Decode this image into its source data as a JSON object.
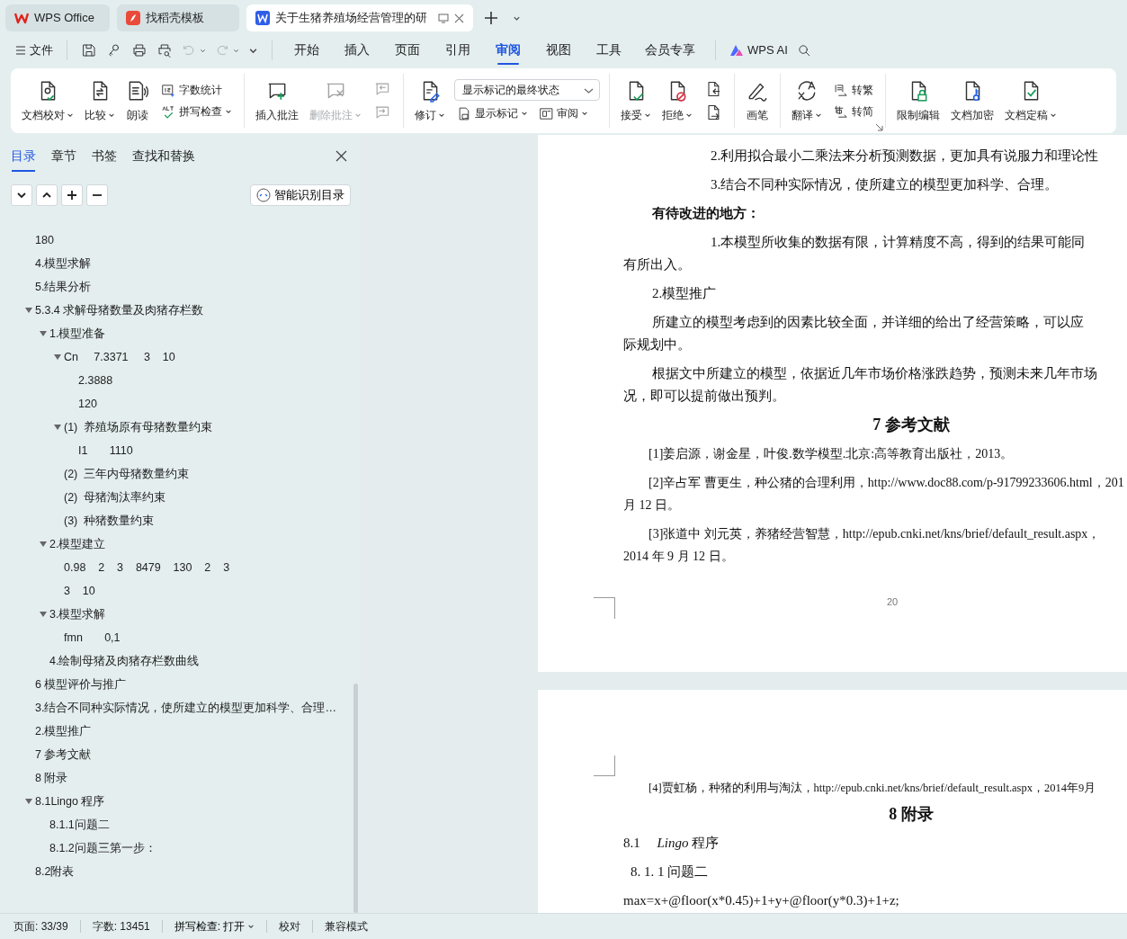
{
  "app_tabs": [
    {
      "kind": "home",
      "title": "WPS Office",
      "selected": false
    },
    {
      "kind": "template",
      "title": "找稻壳模板",
      "selected": false
    },
    {
      "kind": "document",
      "title": "关于生猪养殖场经营管理的研",
      "selected": true
    }
  ],
  "menu": {
    "file": "文件",
    "tabs": [
      {
        "label": "开始",
        "selected": false
      },
      {
        "label": "插入",
        "selected": false
      },
      {
        "label": "页面",
        "selected": false
      },
      {
        "label": "引用",
        "selected": false
      },
      {
        "label": "审阅",
        "selected": true
      },
      {
        "label": "视图",
        "selected": false
      },
      {
        "label": "工具",
        "selected": false
      },
      {
        "label": "会员专享",
        "selected": false
      }
    ],
    "ai": "WPS AI"
  },
  "ribbon": [
    {
      "items": [
        {
          "kind": "big",
          "label": "文档校对",
          "caret": true,
          "disabled": false
        },
        {
          "kind": "big",
          "label": "比较",
          "caret": true,
          "disabled": false
        },
        {
          "kind": "big",
          "label": "朗读",
          "disabled": false
        },
        {
          "kind": "stack",
          "rows": [
            [
              {
                "kind": "small",
                "label": "字数统计",
                "disabled": false
              }
            ],
            [
              {
                "kind": "small",
                "label": "拼写检查",
                "caret": true,
                "disabled": false
              }
            ]
          ]
        }
      ]
    },
    {
      "items": [
        {
          "kind": "big",
          "label": "插入批注",
          "disabled": false
        },
        {
          "kind": "big",
          "label": "删除批注",
          "caret": true,
          "disabled": true
        },
        {
          "kind": "stack",
          "rows": [
            [
              {
                "kind": "small",
                "disabled": true
              }
            ],
            [
              {
                "kind": "small",
                "disabled": true
              }
            ]
          ]
        }
      ]
    },
    {
      "items": [
        {
          "kind": "big",
          "label": "修订",
          "caret": true,
          "disabled": false
        },
        {
          "kind": "stack",
          "rows": [
            [
              {
                "kind": "select",
                "value": "显示标记的最终状态"
              }
            ],
            [
              {
                "kind": "small",
                "label": "显示标记",
                "caret": true,
                "disabled": false
              },
              {
                "kind": "small",
                "label": "审阅",
                "caret": true,
                "disabled": false
              }
            ]
          ]
        }
      ]
    },
    {
      "items": [
        {
          "kind": "big",
          "label": "接受",
          "caret": true,
          "disabled": false
        },
        {
          "kind": "big",
          "label": "拒绝",
          "caret": true,
          "disabled": false
        },
        {
          "kind": "stack",
          "rows": [
            [
              {
                "kind": "small",
                "disabled": false
              }
            ],
            [
              {
                "kind": "small",
                "disabled": false
              }
            ]
          ]
        }
      ]
    },
    {
      "items": [
        {
          "kind": "big",
          "label": "画笔",
          "disabled": false
        }
      ]
    },
    {
      "launcher": true,
      "items": [
        {
          "kind": "big",
          "label": "翻译",
          "caret": true,
          "disabled": false
        },
        {
          "kind": "stack",
          "rows": [
            [
              {
                "kind": "small",
                "label": "转繁",
                "disabled": false
              }
            ],
            [
              {
                "kind": "small",
                "label": "转简",
                "disabled": false
              }
            ]
          ]
        }
      ]
    },
    {
      "items": [
        {
          "kind": "big",
          "label": "限制编辑",
          "disabled": false
        },
        {
          "kind": "big",
          "label": "文档加密",
          "disabled": false
        },
        {
          "kind": "big",
          "label": "文档定稿",
          "caret": true,
          "disabled": false
        }
      ]
    }
  ],
  "sidebar": {
    "tabs": [
      {
        "label": "目录",
        "selected": true
      },
      {
        "label": "章节",
        "selected": false
      },
      {
        "label": "书签",
        "selected": false
      },
      {
        "label": "查找和替换",
        "selected": false
      }
    ],
    "smart_toc_button": "智能识别目录",
    "toc": [
      {
        "text": "180"
      },
      {
        "text": "4.模型求解"
      },
      {
        "text": "5.结果分析"
      },
      {
        "text": "5.3.4 求解母猪数量及肉猪存栏数",
        "expanded": true,
        "children": [
          {
            "text": "1.模型准备",
            "expanded": true,
            "children": [
              {
                "text": "Cn     7.3371     3    10",
                "expanded": true,
                "children": [
                  {
                    "text": "2.3888"
                  },
                  {
                    "text": "120"
                  }
                ]
              },
              {
                "text": "(1)  养殖场原有母猪数量约束",
                "expanded": true,
                "children": [
                  {
                    "text": "I1       1110"
                  }
                ]
              },
              {
                "text": "(2)  三年内母猪数量约束"
              },
              {
                "text": "(2)  母猪淘汰率约束"
              },
              {
                "text": "(3)  种猪数量约束"
              }
            ]
          },
          {
            "text": "2.模型建立",
            "expanded": true,
            "children": [
              {
                "text": "0.98    2    3    8479    130    2    3"
              },
              {
                "text": "3    10"
              }
            ]
          },
          {
            "text": "3.模型求解",
            "expanded": true,
            "children": [
              {
                "text": "fmn       0,1"
              }
            ]
          },
          {
            "text": "4.绘制母猪及肉猪存栏数曲线"
          }
        ]
      },
      {
        "text": "6 模型评价与推广"
      },
      {
        "text": "3.结合不同种实际情况，使所建立的模型更加科学、合理…"
      },
      {
        "text": "2.模型推广"
      },
      {
        "text": "7 参考文献"
      },
      {
        "text": "8 附录"
      },
      {
        "text": "8.1Lingo 程序",
        "expanded": true,
        "children": [
          {
            "text": "8.1.1问题二"
          },
          {
            "text": "8.1.2问题三第一步："
          }
        ]
      },
      {
        "text": "8.2附表"
      }
    ]
  },
  "document": {
    "pages": [
      {
        "page_number": "20",
        "blocks": [
          {
            "kind": "item",
            "lines": [
              "2.利用拟合最小二乘法来分析预测数据，更加具有说服力和理论性"
            ]
          },
          {
            "kind": "item",
            "lines": [
              "3.结合不同种实际情况，使所建立的模型更加科学、合理。"
            ]
          },
          {
            "kind": "label",
            "lines": [
              "有待改进的地方："
            ]
          },
          {
            "kind": "item",
            "lines": [
              "1.本模型所收集的数据有限，计算精度不高，得到的结果可能同",
              "有所出入。"
            ]
          },
          {
            "kind": "label",
            "lines": [
              "2.模型推广"
            ]
          },
          {
            "kind": "text",
            "lines": [
              "所建立的模型考虑到的因素比较全面，并详细的给出了经营策略，可以应",
              "际规划中。"
            ]
          },
          {
            "kind": "text",
            "lines": [
              "根据文中所建立的模型，依据近几年市场价格涨跌趋势，预测未来几年市场",
              "况，即可以提前做出预判。"
            ]
          },
          {
            "kind": "heading",
            "lines": [
              "7 参考文献"
            ]
          },
          {
            "kind": "ref",
            "lines": [
              "[1]姜启源，谢金星，叶俊.数学模型.北京:高等教育出版社，2013。"
            ]
          },
          {
            "kind": "ref",
            "lines": [
              "[2]辛占军 曹更生，种公猪的合理利用，http://www.doc88.com/p-91799233606.html，201",
              "月 12 日。"
            ]
          },
          {
            "kind": "ref",
            "lines": [
              "[3]张道中 刘元英，养猪经营智慧，http://epub.cnki.net/kns/brief/default_result.aspx，",
              "2014 年 9 月 12 日。"
            ]
          }
        ]
      },
      {
        "blocks": [
          {
            "kind": "smallref",
            "lines": [
              "[4]贾虹杨，种猪的利用与淘汰，http://epub.cnki.net/kns/brief/default_result.aspx，2014年9月"
            ]
          },
          {
            "kind": "heading",
            "lines": [
              "8 附录"
            ]
          },
          {
            "kind": "sub",
            "lines": [
              "8.1　 *Lingo* 程序"
            ]
          },
          {
            "kind": "sub2",
            "lines": [
              "8. 1. 1 问题二"
            ]
          },
          {
            "kind": "code",
            "lines": [
              "max=x+@floor(x*0.45)+1+y+@floor(y*0.3)+1+z;"
            ]
          }
        ]
      }
    ]
  },
  "status_bar": [
    {
      "text": "页面: 33/39"
    },
    {
      "text": "字数: 13451"
    },
    {
      "text": "拼写检查: 打开",
      "caret": true
    },
    {
      "text": "校对"
    },
    {
      "text": "兼容模式"
    }
  ]
}
